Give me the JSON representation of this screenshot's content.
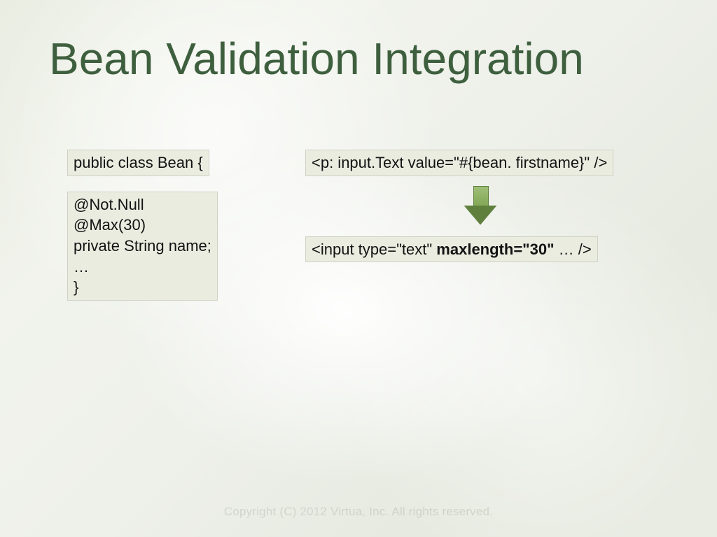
{
  "title": "Bean Validation Integration",
  "left_code": {
    "block1": "public class Bean {",
    "block2": "@Not.Null\n@Max(30)\nprivate String name;\n…\n}"
  },
  "right_code": {
    "block1": "<p: input.Text value=\"#{bean. firstname}\" />",
    "block2_prefix": "<input type=\"text\" ",
    "block2_bold": "maxlength=\"30\"",
    "block2_suffix": " … />"
  },
  "footer": "Copyright (C) 2012 Virtua, Inc. All rights reserved."
}
